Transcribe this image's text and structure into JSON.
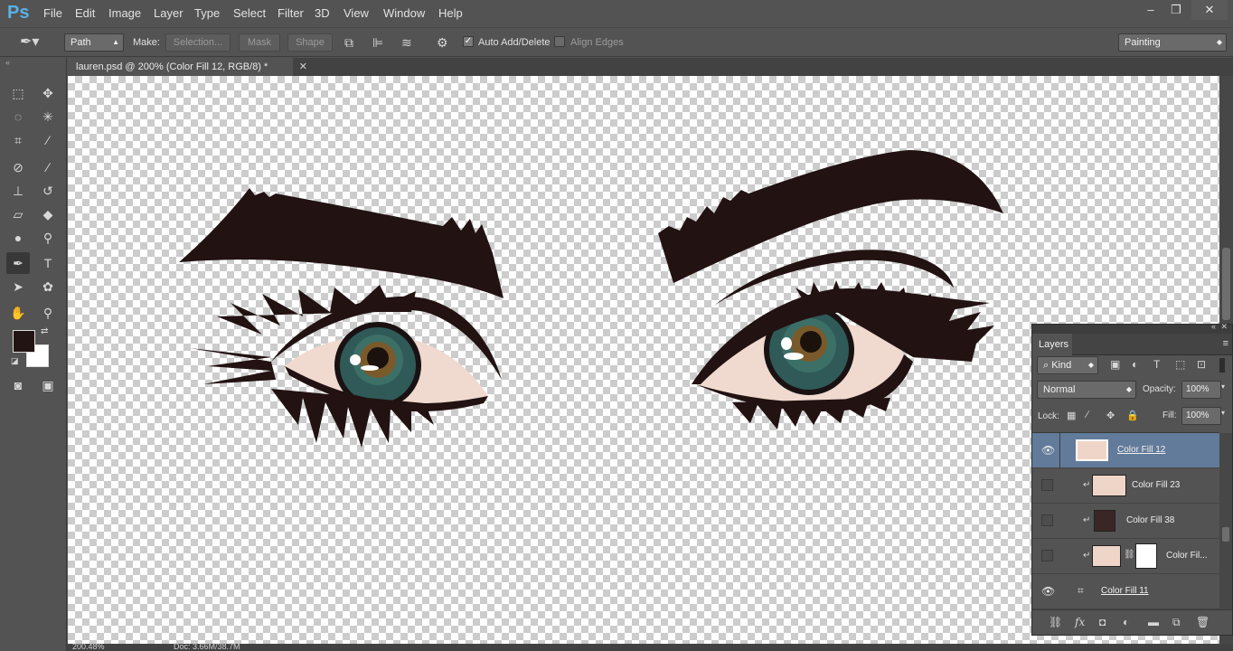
{
  "app": {
    "logo": "Ps"
  },
  "menu": [
    "File",
    "Edit",
    "Image",
    "Layer",
    "Type",
    "Select",
    "Filter",
    "3D",
    "View",
    "Window",
    "Help"
  ],
  "window_controls": {
    "minimize": "–",
    "restore": "❐",
    "close": "✕"
  },
  "options": {
    "mode": "Path",
    "make_label": "Make:",
    "selection_btn": "Selection...",
    "mask_btn": "Mask",
    "shape_btn": "Shape",
    "auto_add_delete": "Auto Add/Delete",
    "auto_add_checked": true,
    "align_edges": "Align Edges",
    "align_edges_checked": false,
    "workspace": "Painting"
  },
  "document": {
    "tab_title": "lauren.psd @ 200% (Color Fill 12, RGB/8) *",
    "close": "✕"
  },
  "status": {
    "zoom": "200.48%",
    "doc": "Doc: 3.66M/38.7M"
  },
  "colors": {
    "foreground": "#231414",
    "background": "#ffffff",
    "selected_layer": "#627b9a",
    "brow": "#221212",
    "iris": "#2f5a58",
    "skin": "#f0d9cf"
  },
  "layers_panel": {
    "tab": "Layers",
    "filter": "Kind",
    "blend_mode": "Normal",
    "opacity_label": "Opacity:",
    "opacity": "100%",
    "lock_label": "Lock:",
    "fill_label": "Fill:",
    "fill": "100%",
    "layers": [
      {
        "name": "Color Fill 12",
        "visible": true,
        "selected": true,
        "clipped": false
      },
      {
        "name": "Color Fill 23",
        "visible": false,
        "selected": false,
        "clipped": true
      },
      {
        "name": "Color Fill 38",
        "visible": false,
        "selected": false,
        "clipped": true
      },
      {
        "name": "Color Fil...",
        "visible": false,
        "selected": false,
        "clipped": true
      },
      {
        "name": "Color Fill 11",
        "visible": true,
        "selected": false,
        "clipped": false
      }
    ]
  }
}
